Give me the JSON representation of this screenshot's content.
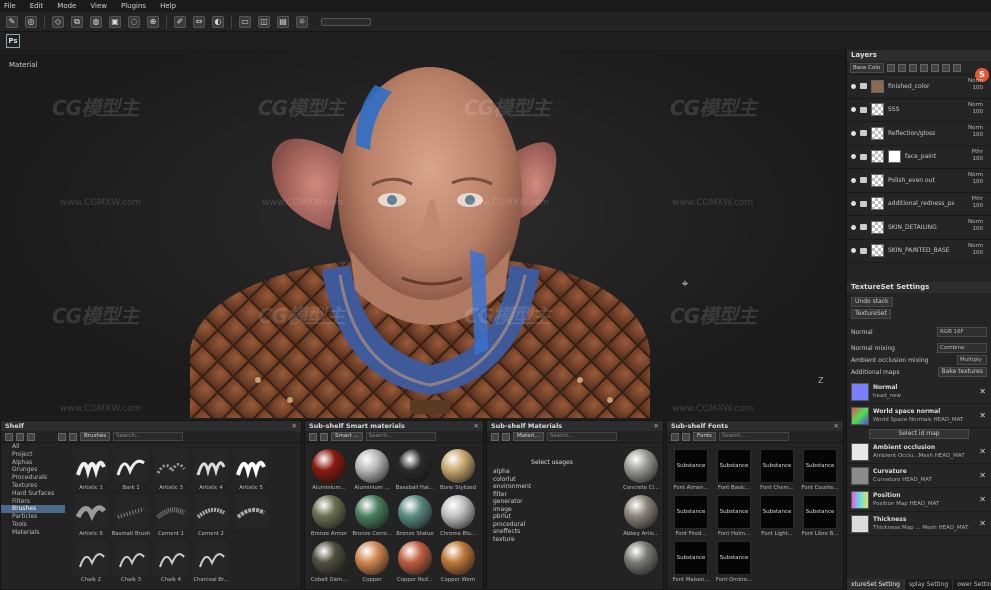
{
  "menu": [
    "File",
    "Edit",
    "Mode",
    "View",
    "Plugins",
    "Help"
  ],
  "toolbar": {
    "icons": [
      "paint-icon",
      "projection-icon",
      "erase-icon",
      "clone-icon",
      "smudge-icon",
      "polyfill-icon",
      "lasso-icon",
      "picker-icon",
      "brush-mode-icon",
      "symmetry-icon",
      "mask-icon",
      "camera-icon",
      "cube-icon",
      "display-icon",
      "light-icon"
    ],
    "ps_label": "Ps"
  },
  "viewport": {
    "label": "Material",
    "axis_label": "Z",
    "crosshair": "⌖",
    "watermarks": [
      "CG模型主",
      "CG模型主",
      "CG模型主",
      "CG模型主",
      "CG模型主",
      "CG模型主",
      "CG模型主",
      "CG模型主"
    ],
    "watermark_url": "www.CGMXW.com"
  },
  "layers": {
    "title": "Layers",
    "select_label": "Base Colo",
    "logo": "S",
    "items": [
      {
        "name": "finished_color",
        "blend": "Norm",
        "opacity": "100"
      },
      {
        "name": "SSS",
        "blend": "Norm",
        "opacity": "100"
      },
      {
        "name": "Reflection/gloss",
        "blend": "Norm",
        "opacity": "100"
      },
      {
        "name": "face_paint",
        "blend": "Pthr",
        "opacity": "100"
      },
      {
        "name": "Polish_even out",
        "blend": "Norm",
        "opacity": "100"
      },
      {
        "name": "additional_redness_patc...",
        "blend": "Pthr",
        "opacity": "100"
      },
      {
        "name": "SKIN_DETAILING",
        "blend": "Norm",
        "opacity": "100"
      },
      {
        "name": "SKIN_PAINTED_BASE",
        "blend": "Norm",
        "opacity": "100"
      }
    ]
  },
  "textureset": {
    "title": "TextureSet Settings",
    "undo_stack": "Undo stack",
    "texture_list": "TextureSet",
    "normal_label": "Normal",
    "normal_format": "RGB 16F",
    "normal_mixing_label": "Normal mixing",
    "normal_mixing_value": "Combine",
    "ao_mixing_label": "Ambient occlusion mixing",
    "ao_mixing_value": "Multiply",
    "additional_maps": "Additional maps",
    "bake_button": "Bake textures",
    "maps": [
      {
        "title": "Normal",
        "sub": "head_new",
        "color": "#7d7dff"
      },
      {
        "title": "World space normal",
        "sub": "World Space Normals HEAD_MAT",
        "color": "multi"
      },
      {
        "title": "Ambient occlusion",
        "sub": "Ambient Occlu...Mesh HEAD_MAT",
        "color": "#e8e8e8"
      },
      {
        "title": "Curvature",
        "sub": "Curvature HEAD_MAT",
        "color": "#8c8c8c"
      },
      {
        "title": "Position",
        "sub": "Position Map HEAD_MAT",
        "color": "multi2"
      },
      {
        "title": "Thickness",
        "sub": "Thickness Map ... Mesh HEAD_MAT",
        "color": "#dcdcdc"
      }
    ],
    "select_map": "Select id map",
    "tabs": [
      "xtureSet Setting",
      "splay Setting",
      "ower Setting"
    ]
  },
  "shelf": {
    "title": "Shelf",
    "categories": [
      "All",
      "Project",
      "Alphas",
      "Grunges",
      "Procedurals",
      "Textures",
      "Hard Surfaces",
      "Filters",
      "Brushes",
      "Particles",
      "Tools",
      "Materials"
    ],
    "selected_category": "Brushes",
    "tag": "Brushes",
    "search": "Search...",
    "brushes": [
      "Artistic 1",
      "Bark 1",
      "Artistic 3",
      "Artistic 4",
      "Artistic 5",
      "Artistic 6",
      "Basmati Brush",
      "Cement 1",
      "Cement 2",
      "",
      "Chalk 2",
      "Chalk 3",
      "Chalk 4",
      "Charcoal Br..."
    ]
  },
  "smart_materials": {
    "title": "Sub-shelf Smart materials",
    "tag": "Smart ...",
    "search": "Search...",
    "items": [
      {
        "name": "Aluminium...",
        "color": "#8a1a10"
      },
      {
        "name": "Aluminium ...",
        "color": "#b8b8b8"
      },
      {
        "name": "Baseball Hat...",
        "color": "#2a2a2a"
      },
      {
        "name": "Bone Stylized",
        "color": "#c8a870"
      },
      {
        "name": "Bronze Armor",
        "color": "#6a7050"
      },
      {
        "name": "Bronze Corro...",
        "color": "#4a8060"
      },
      {
        "name": "Bronze Statue",
        "color": "#5a8a80"
      },
      {
        "name": "Chrome Blo...",
        "color": "#c0c0c0"
      },
      {
        "name": "Cobalt Dam...",
        "color": "#505040"
      },
      {
        "name": "Copper",
        "color": "#d08850"
      },
      {
        "name": "Copper Red...",
        "color": "#c06040"
      },
      {
        "name": "Copper Worn",
        "color": "#c07838"
      }
    ]
  },
  "materials": {
    "title": "Sub-shelf Materials",
    "tag": "Materi...",
    "search": "Search...",
    "select_usages": "Select usages",
    "usages": [
      "alpha",
      "colorlut",
      "environment",
      "filter",
      "generator",
      "image",
      "pbrlut",
      "procedural",
      "sneffects",
      "texture"
    ],
    "items": [
      {
        "name": "Concrete Cl...",
        "color": "#9a9a96"
      },
      {
        "name": "Abbey Artis...",
        "color": "#8a8478"
      },
      {
        "name": "",
        "color": "#7a7a76"
      }
    ]
  },
  "fonts": {
    "title": "Sub-shelf Fonts",
    "tag": "Fonts",
    "search": "Search...",
    "items": [
      {
        "sample": "Substance",
        "name": "Font Aimen..."
      },
      {
        "sample": "Substance",
        "name": "Font Basic..."
      },
      {
        "sample": "Substance",
        "name": "Font Chem..."
      },
      {
        "sample": "Substance",
        "name": "Font Counte..."
      },
      {
        "sample": "Substance",
        "name": "Font Fired..."
      },
      {
        "sample": "Substance",
        "name": "Font Holm..."
      },
      {
        "sample": "Substance",
        "name": "Font Light..."
      },
      {
        "sample": "Substance",
        "name": "Font Libre B..."
      },
      {
        "sample": "Substance",
        "name": "Font Maisen..."
      },
      {
        "sample": "Substance",
        "name": "Font Ombre..."
      }
    ]
  }
}
